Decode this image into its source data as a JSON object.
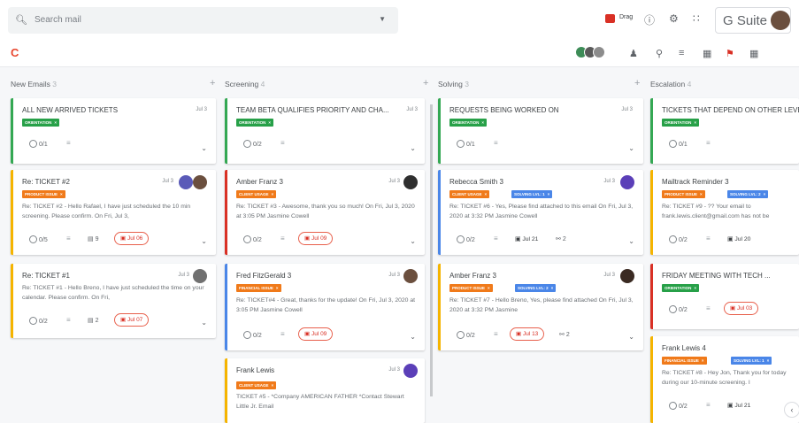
{
  "header": {
    "search_placeholder": "Search mail",
    "drag_label": "Drag",
    "gsuite_label": "G Suite"
  },
  "icons": {
    "search": "search-icon",
    "help": "help-icon",
    "settings": "gear-icon",
    "apps": "apps-grid-icon",
    "refresh": "refresh-icon",
    "add_user": "add-user-icon",
    "filter": "filter-icon",
    "sort": "sort-icon",
    "columns": "columns-icon",
    "bookmark": "bookmark-icon",
    "more": "more-icon"
  },
  "colors": {
    "orientation": "#27a048",
    "issue": "#f07a1a",
    "solving": "#4a86e8",
    "green_border": "#34a853",
    "orange_border": "#f5b400",
    "red_border": "#d93025",
    "blue_border": "#4a86e8"
  },
  "columns": [
    {
      "title": "New Emails",
      "count": "3"
    },
    {
      "title": "Screening",
      "count": "4"
    },
    {
      "title": "Solving",
      "count": "3"
    },
    {
      "title": "Escalation",
      "count": "4"
    }
  ],
  "cards": {
    "c1": {
      "title": "ALL NEW ARRIVED TICKETS",
      "date": "Jul 3",
      "tag": "ORIENTATION",
      "checklist": "0/1"
    },
    "c2": {
      "title": "Re: TICKET #2",
      "date": "Jul 3",
      "tag": "PRODUCT ISSUE",
      "desc": "Re: TICKET #2 - Hello Rafael, I have just scheduled the 10 min screening. Please confirm. On Fri, Jul 3,",
      "checklist": "0/5",
      "comments": "9",
      "due": "Jul 06"
    },
    "c3": {
      "title": "Re: TICKET #1",
      "date": "Jul 3",
      "desc": "Re: TICKET #1 - Hello Breno, I have just scheduled the time on your calendar. Please confirm. On Fri,",
      "checklist": "0/2",
      "comments": "2",
      "due": "Jul 07"
    },
    "c4": {
      "title": "TEAM BETA QUALIFIES PRIORITY AND CHA...",
      "date": "Jul 3",
      "tag": "ORIENTATION",
      "checklist": "0/2"
    },
    "c5": {
      "title": "Amber Franz 3",
      "date": "Jul 3",
      "tag": "CLIENT USAGE",
      "desc": "Re: TICKET #3 - Awesome, thank you so much! On Fri, Jul 3, 2020 at 3:05 PM Jasmine Cowell",
      "checklist": "0/2",
      "due": "Jul 09"
    },
    "c6": {
      "title": "Fred FitzGerald 3",
      "date": "Jul 3",
      "tag": "FINANCIAL ISSUE",
      "desc": "Re: TICKET#4 - Great, thanks for the update! On Fri, Jul 3, 2020 at 3:05 PM Jasmine Cowell",
      "checklist": "0/2",
      "due": "Jul 09"
    },
    "c7": {
      "title": "Frank Lewis",
      "date": "Jul 3",
      "tag": "CLIENT USAGE",
      "desc": "TICKET #5 - *Company AMERICAN FATHER *Contact Stewart Little Jr. Email"
    },
    "c8": {
      "title": "REQUESTS BEING WORKED ON",
      "date": "Jul 3",
      "tag": "ORIENTATION",
      "checklist": "0/1"
    },
    "c9": {
      "title": "Rebecca Smith 3",
      "date": "Jul 3",
      "tag1": "CLIENT USAGE",
      "tag2": "SOLVING LVL: 1",
      "desc": "Re: TICKET #6 - Yes, Please find attached to this email On Fri, Jul 3, 2020 at 3:32 PM Jasmine Cowell",
      "checklist": "0/2",
      "due": "Jul 21",
      "count": "2"
    },
    "c10": {
      "title": "Amber Franz 3",
      "date": "Jul 3",
      "tag1": "PRODUCT ISSUE",
      "tag2": "SOLVING LVL: 2",
      "desc": "Re: TICKET #7 - Hello Breno, Yes, please find attached On Fri, Jul 3, 2020 at 3:32 PM Jasmine",
      "checklist": "0/2",
      "due": "Jul 13",
      "count": "2"
    },
    "c11": {
      "title": "TICKETS THAT DEPEND ON OTHER LEVE",
      "tag": "ORIENTATION",
      "checklist": "0/1"
    },
    "c12": {
      "title": "Mailtrack Reminder 3",
      "tag1": "PRODUCT ISSUE",
      "tag2": "SOLVING LVL: 2",
      "desc": "Re: TICKET #9 - ?? Your email to frank.lewis.client@gmail.com has not be",
      "checklist": "0/2",
      "due": "Jul 20"
    },
    "c13": {
      "title": "FRIDAY MEETING WITH TECH ...",
      "tag": "ORIENTATION",
      "checklist": "0/2",
      "due": "Jul 03"
    },
    "c14": {
      "title": "Frank Lewis 4",
      "tag1": "FINANCIAL ISSUE",
      "tag2": "SOLVING LVL: 1",
      "desc": "Re: TICKET #8 - Hey Jon, Thank you for today during our 10-minute screening. I",
      "checklist": "0/2",
      "due": "Jul 21"
    }
  }
}
